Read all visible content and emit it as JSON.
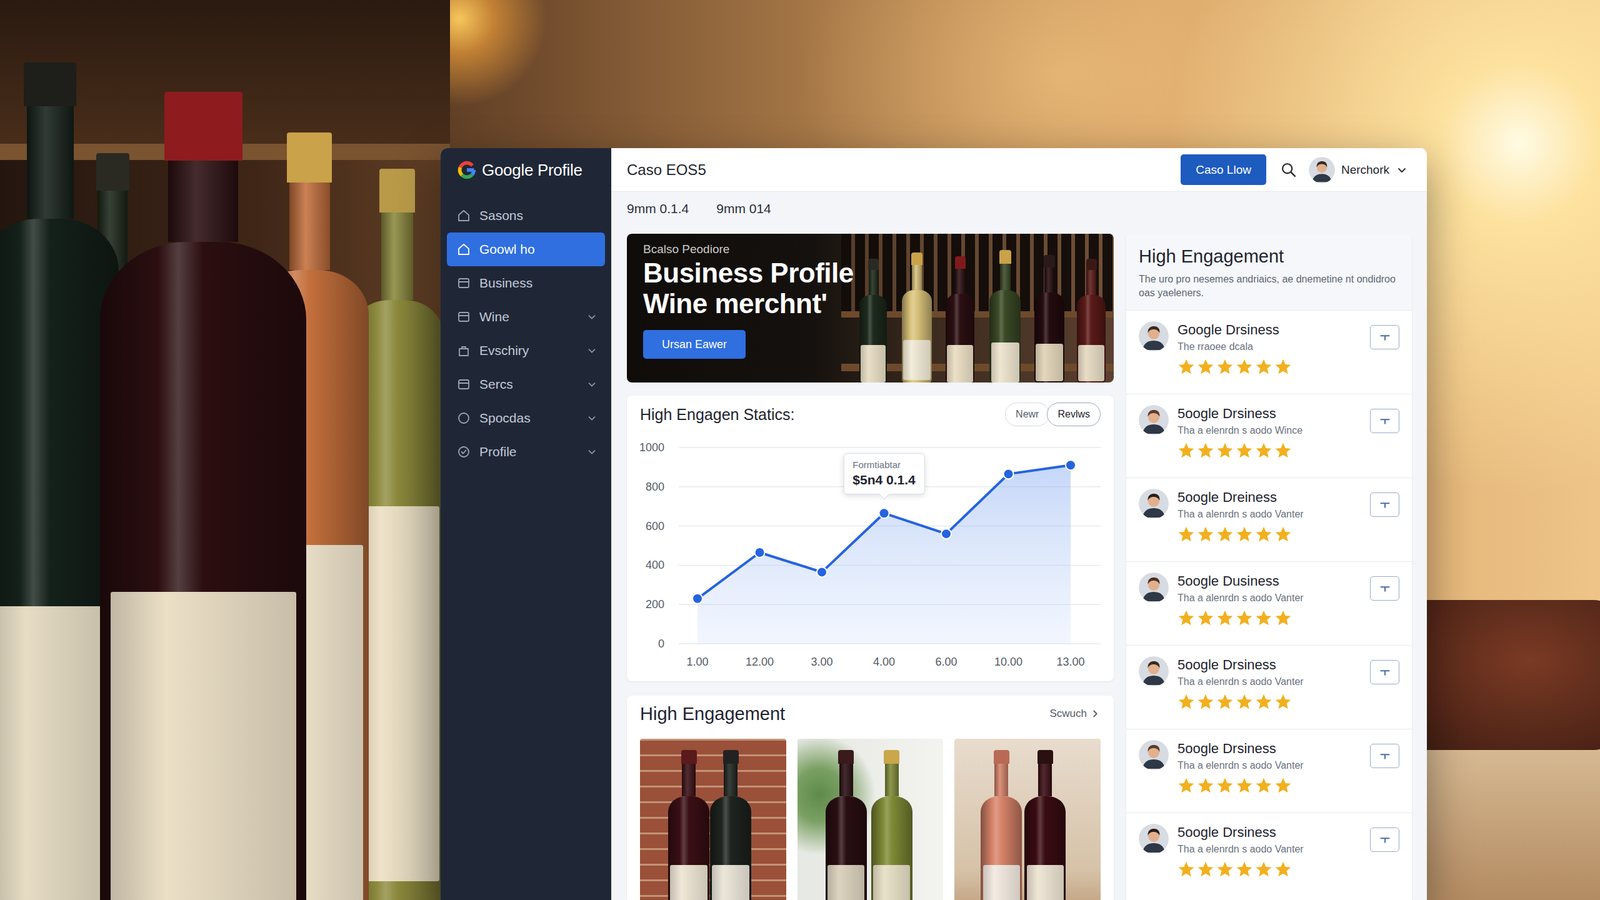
{
  "sidebar": {
    "logo": "Google Profile",
    "items": [
      {
        "label": "Sasons",
        "selected": false,
        "has_submenu": false
      },
      {
        "label": "Goowl ho",
        "selected": true,
        "has_submenu": false
      },
      {
        "label": "Business",
        "selected": false,
        "has_submenu": false
      },
      {
        "label": "Wine",
        "selected": false,
        "has_submenu": true
      },
      {
        "label": "Evschiry",
        "selected": false,
        "has_submenu": true
      },
      {
        "label": "Sercs",
        "selected": false,
        "has_submenu": true
      },
      {
        "label": "Spocdas",
        "selected": false,
        "has_submenu": true
      },
      {
        "label": "Profile",
        "selected": false,
        "has_submenu": true
      }
    ]
  },
  "topbar": {
    "title": "Caso EOS5",
    "button": "Caso Llow",
    "user": "Nerchork"
  },
  "subheader": [
    "9mm 0.1.4",
    "9mm 014"
  ],
  "hero": {
    "eyebrow": "Bcalso Peodiore",
    "title_lines": [
      "Business Profile",
      "Wine merchnt'"
    ],
    "button": "Ursan Eawer"
  },
  "chart": {
    "title": "High Engagen Statics:",
    "tabs": [
      {
        "label": "Newr",
        "selected": false
      },
      {
        "label": "Revlws",
        "selected": true
      }
    ],
    "y_ticks": [
      "1000",
      "800",
      "600",
      "400",
      "200",
      "0"
    ],
    "x_labels": [
      "1.00",
      "12.00",
      "3.00",
      "4.00",
      "6.00",
      "10.00",
      "13.00"
    ],
    "series": [
      {
        "values": [
          230,
          465,
          365,
          665,
          560,
          865,
          910
        ]
      }
    ],
    "tooltip": {
      "index": 3,
      "title": "Formtiabtar",
      "value": "$5n4 0.1.4"
    }
  },
  "gallery": {
    "title": "High Engagement",
    "link": "Scwuch",
    "photos": [
      {
        "kind": "brick"
      },
      {
        "kind": "plant"
      },
      {
        "kind": "wood"
      }
    ]
  },
  "reviews": {
    "title": "High Engagement",
    "description": "The uro pro nesemes andriaics, ae dnemetine nt ondidroo oas yaeleners.",
    "items": [
      {
        "name": "Google Drsiness",
        "subtitle": "The rraoee dcala",
        "stars": 6
      },
      {
        "name": "5oogle Drsiness",
        "subtitle": "Tha a elenrdn s aodo Wince",
        "stars": 6
      },
      {
        "name": "5oogle Dreiness",
        "subtitle": "Tha a alenrdn s aodo Vanter",
        "stars": 6
      },
      {
        "name": "5oogle Dusiness",
        "subtitle": "Tha a alenrdn s aodo Vanter",
        "stars": 6
      },
      {
        "name": "5oogle Drsiness",
        "subtitle": "Tha a elenrdn s aodo Vanter",
        "stars": 6
      },
      {
        "name": "5oogle Drsiness",
        "subtitle": "Tha a elenrdn s aodo Vanter",
        "stars": 6
      },
      {
        "name": "5oogle Drsiness",
        "subtitle": "Tha a elenrdn s aodo Vanter",
        "stars": 6
      }
    ]
  }
}
